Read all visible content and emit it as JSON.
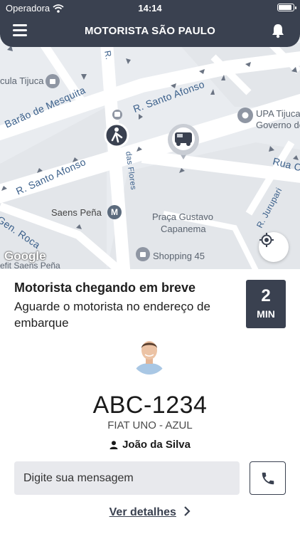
{
  "status_bar": {
    "carrier": "Operadora",
    "time": "14:14"
  },
  "header": {
    "title": "MOTORISTA SÃO PAULO",
    "menu_icon": "hamburger-menu-icon",
    "bell_icon": "bell-icon"
  },
  "map": {
    "streets": [
      "R. Santo Afonso",
      "R. Santo Afonso",
      "Barão de Mesquita",
      "Gen. Roca",
      "Rua C",
      "R. Jurupari",
      "das Flores",
      "R."
    ],
    "pois": {
      "ula_tijuca": "cula Tijuca",
      "upa": "UPA Tijuca",
      "governo": "Governo de",
      "saens": "Saens Peña",
      "metro_badge": "M",
      "praca_1": "Praça Gustavo",
      "praca_2": "Capanema",
      "shopping": "Shopping 45",
      "efit": "efit Saens Peña"
    },
    "google_logo": "Google",
    "locate_icon": "crosshair-location-icon",
    "car_icon": "car-marker-icon"
  },
  "trip": {
    "title": "Motorista chegando em breve",
    "subtitle": "Aguarde o motorista no endereço de embarque",
    "eta_value": "2",
    "eta_unit": "MIN"
  },
  "vehicle": {
    "plate": "ABC-1234",
    "model": "FIAT UNO - AZUL",
    "driver_name": "João da Silva"
  },
  "message": {
    "placeholder": "Digite sua mensagem"
  },
  "actions": {
    "details_label": "Ver detalhes"
  },
  "colors": {
    "header_bg": "#3a4150",
    "accent": "#3a4150",
    "map_bg": "#eef1f4",
    "street_text": "#3a5f8a"
  }
}
